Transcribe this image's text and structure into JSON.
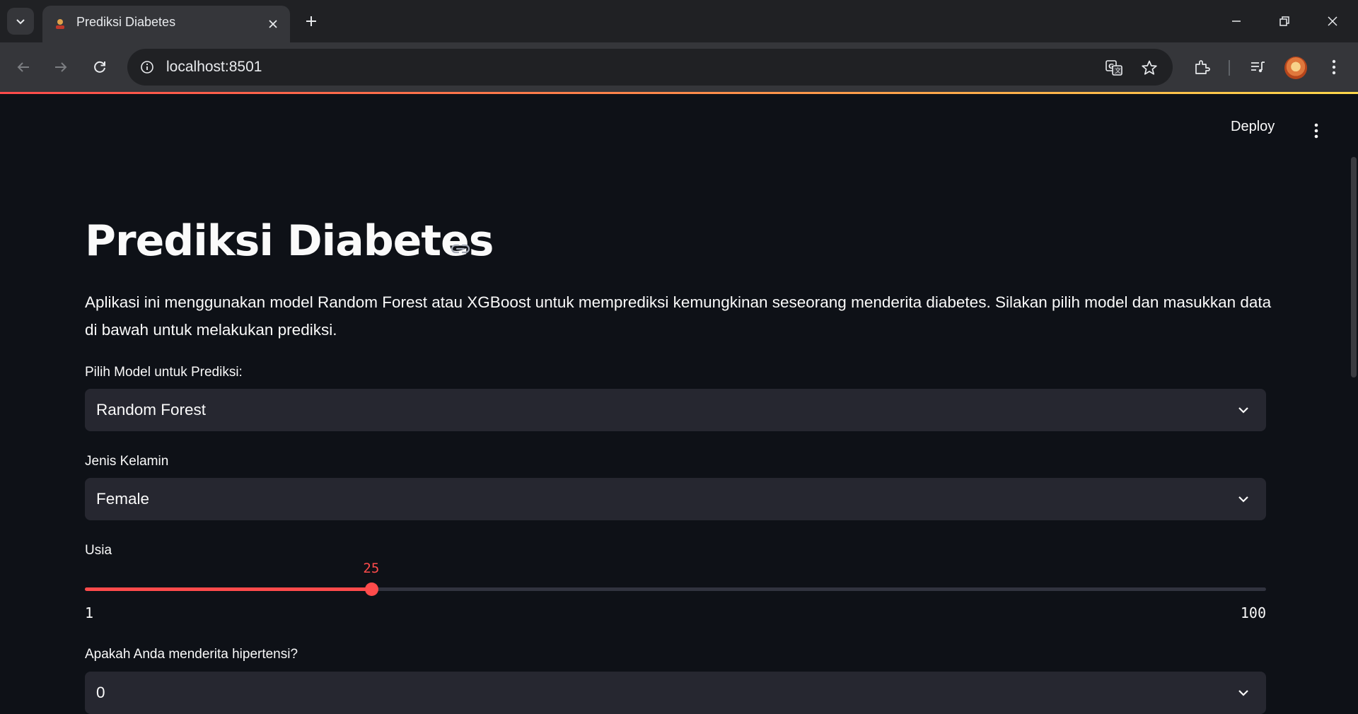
{
  "browser": {
    "tab_title": "Prediksi Diabetes",
    "url": "localhost:8501"
  },
  "header": {
    "deploy_label": "Deploy"
  },
  "main": {
    "title": "Prediksi Diabetes",
    "description": "Aplikasi ini menggunakan model Random Forest atau XGBoost untuk memprediksi kemungkinan seseorang menderita diabetes. Silakan pilih model dan masukkan data di bawah untuk melakukan prediksi.",
    "model_select": {
      "label": "Pilih Model untuk Prediksi:",
      "value": "Random Forest"
    },
    "gender_select": {
      "label": "Jenis Kelamin",
      "value": "Female"
    },
    "age_slider": {
      "label": "Usia",
      "value": 25,
      "min": 1,
      "max": 100
    },
    "hypertension_select": {
      "label": "Apakah Anda menderita hipertensi?",
      "value": "0"
    }
  },
  "colors": {
    "accent": "#ff4b4b",
    "background": "#0e1117",
    "widget_bg": "#262730"
  },
  "icons": [
    "chevron-down-icon",
    "close-icon",
    "plus-icon",
    "minimize-icon",
    "restore-icon",
    "back-arrow-icon",
    "forward-arrow-icon",
    "reload-icon",
    "info-icon",
    "translate-icon",
    "star-icon",
    "extensions-icon",
    "media-queue-icon",
    "kebab-menu-icon",
    "link-icon"
  ]
}
